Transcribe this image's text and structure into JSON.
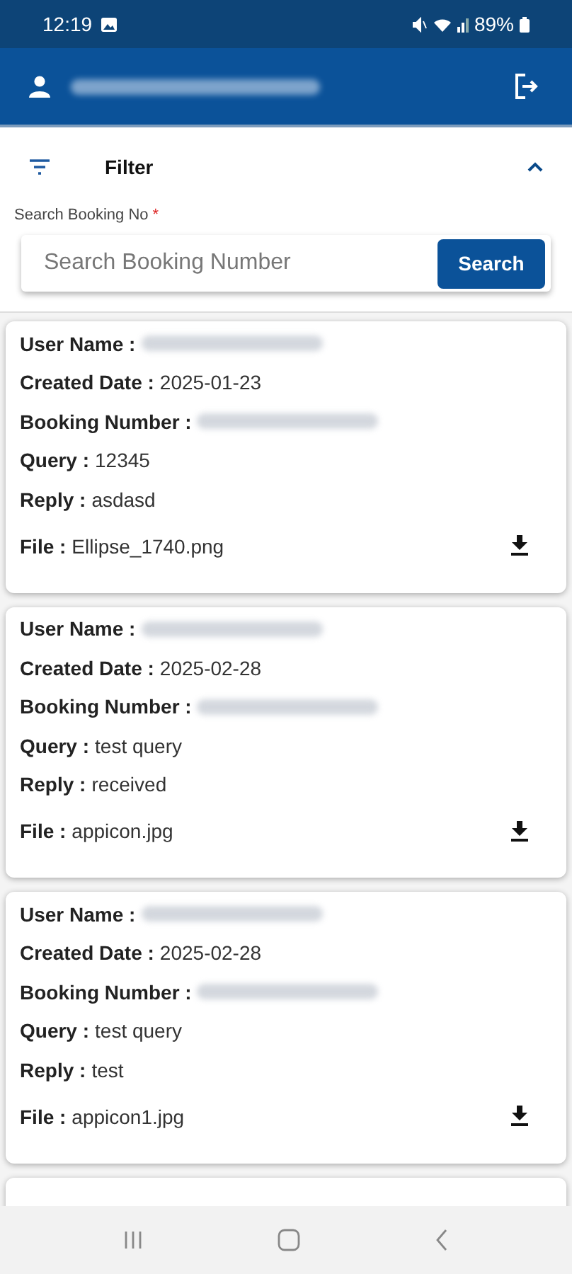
{
  "status_bar": {
    "time": "12:19",
    "battery": "89%"
  },
  "app_bar": {
    "user": {
      "redacted": true
    }
  },
  "filter": {
    "label": "Filter",
    "expanded": true
  },
  "search": {
    "label": "Search Booking No",
    "required": "*",
    "placeholder": "Search Booking Number",
    "button": "Search"
  },
  "cards": [
    {
      "user_name": {
        "label": "User Name :",
        "redacted": true
      },
      "created_date": {
        "label": "Created Date :",
        "value": "2025-01-23"
      },
      "booking_number": {
        "label": "Booking Number :",
        "redacted": true
      },
      "query": {
        "label": "Query :",
        "value": "12345"
      },
      "reply": {
        "label": "Reply :",
        "value": "asdasd"
      },
      "file": {
        "label": "File :",
        "value": "Ellipse_1740.png"
      }
    },
    {
      "user_name": {
        "label": "User Name :",
        "redacted": true
      },
      "created_date": {
        "label": "Created Date :",
        "value": "2025-02-28"
      },
      "booking_number": {
        "label": "Booking Number :",
        "redacted": true
      },
      "query": {
        "label": "Query :",
        "value": "test query"
      },
      "reply": {
        "label": "Reply :",
        "value": "received"
      },
      "file": {
        "label": "File :",
        "value": "appicon.jpg"
      }
    },
    {
      "user_name": {
        "label": "User Name :",
        "redacted": true
      },
      "created_date": {
        "label": "Created Date :",
        "value": "2025-02-28"
      },
      "booking_number": {
        "label": "Booking Number :",
        "redacted": true
      },
      "query": {
        "label": "Query :",
        "value": "test query"
      },
      "reply": {
        "label": "Reply :",
        "value": "test"
      },
      "file": {
        "label": "File :",
        "value": "appicon1.jpg"
      }
    }
  ]
}
